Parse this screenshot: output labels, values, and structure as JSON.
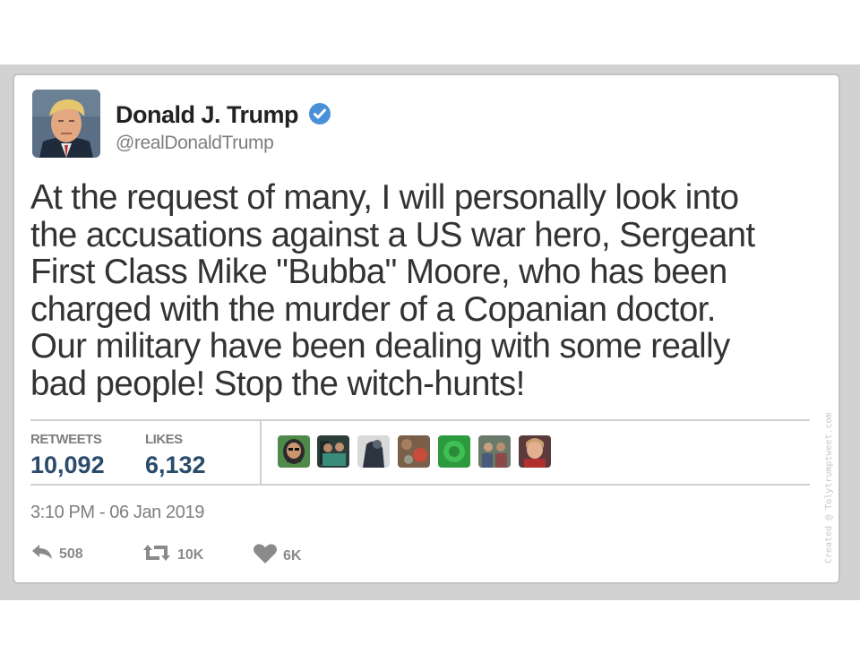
{
  "author": {
    "name": "Donald J. Trump",
    "handle": "@realDonaldTrump",
    "verified": true,
    "avatar": "profile-photo"
  },
  "tweet": {
    "text": "At the request of many, I will personally look into\nthe accusations against a US war hero, Sergeant\nFirst Class Mike \"Bubba\" Moore, who has been\ncharged with the murder of a Copanian doctor.\nOur military have been dealing with some really\nbad people!  Stop the witch-hunts!"
  },
  "stats": {
    "retweets_label": "RETWEETS",
    "retweets_value": "10,092",
    "likes_label": "LIKES",
    "likes_value": "6,132"
  },
  "likers": [
    {
      "avatar": "bearded-man-avatar"
    },
    {
      "avatar": "group-photo-avatar"
    },
    {
      "avatar": "dark-figure-avatar"
    },
    {
      "avatar": "brown-pattern-avatar"
    },
    {
      "avatar": "green-avatar"
    },
    {
      "avatar": "people-photo-avatar"
    },
    {
      "avatar": "woman-avatar"
    }
  ],
  "timestamp": "3:10 PM - 06 Jan 2019",
  "actions": {
    "reply_count": "508",
    "retweet_count": "10K",
    "like_count": "6K"
  },
  "watermark": "Created @ Tolytrumptweet.com",
  "colors": {
    "verified_badge": "#4a90d9",
    "stat_value": "#2a4b6b",
    "muted_text": "#7e7e7e",
    "border": "#c2c2c2"
  }
}
